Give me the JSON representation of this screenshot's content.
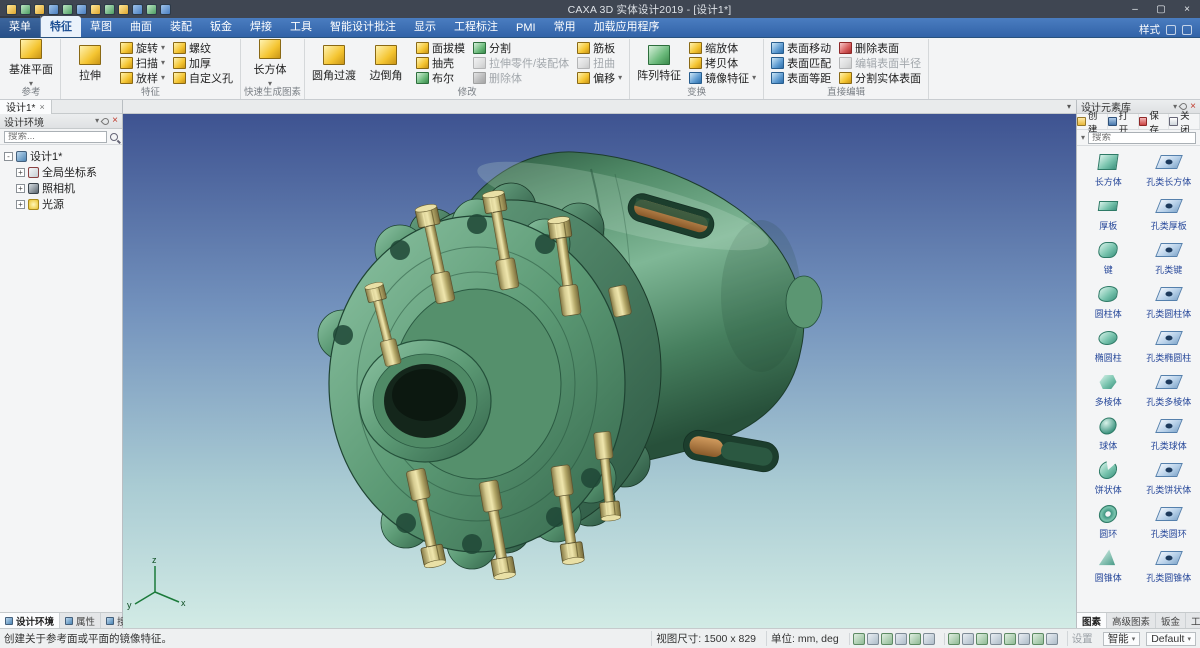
{
  "window": {
    "title": "CAXA 3D 实体设计2019 - [设计1*]",
    "qat_icons": [
      {
        "icon": "app-logo"
      },
      {
        "icon": "new-file"
      },
      {
        "icon": "open-file"
      },
      {
        "icon": "save-file"
      },
      {
        "icon": "print"
      },
      {
        "icon": "undo"
      },
      {
        "icon": "redo"
      },
      {
        "icon": "display-mode"
      },
      {
        "icon": "zoom-all"
      },
      {
        "icon": "settings"
      },
      {
        "icon": "help"
      },
      {
        "icon": "customize"
      }
    ],
    "controls": [
      {
        "icon": "minimize",
        "glyph": "–"
      },
      {
        "icon": "maximize",
        "glyph": "▢"
      },
      {
        "icon": "close",
        "glyph": "×"
      }
    ]
  },
  "menubar": {
    "tabs": [
      {
        "label": "菜单",
        "menu": true
      },
      {
        "label": "特征",
        "active": true
      },
      {
        "label": "草图"
      },
      {
        "label": "曲面"
      },
      {
        "label": "装配"
      },
      {
        "label": "钣金"
      },
      {
        "label": "焊接"
      },
      {
        "label": "工具"
      },
      {
        "label": "智能设计批注"
      },
      {
        "label": "显示"
      },
      {
        "label": "工程标注"
      },
      {
        "label": "PMI"
      },
      {
        "label": "常用"
      },
      {
        "label": "加载应用程序"
      }
    ],
    "style_label": "样式"
  },
  "ribbon": {
    "groups": [
      {
        "label": "参考",
        "items": [
          {
            "label": "基准平面",
            "icon": "datum-plane",
            "big": true,
            "arrow": true
          }
        ]
      },
      {
        "label": "特征",
        "items": [
          {
            "label": "拉伸",
            "icon": "extrude",
            "big": true
          },
          {
            "label": "旋转",
            "icon": "revolve",
            "arrow": true
          },
          {
            "label": "扫描",
            "icon": "sweep",
            "arrow": true
          },
          {
            "label": "放样",
            "icon": "loft",
            "arrow": true
          },
          {
            "label": "螺纹",
            "icon": "thread"
          },
          {
            "label": "加厚",
            "icon": "thicken"
          },
          {
            "label": "自定义孔",
            "icon": "custom-hole"
          }
        ]
      },
      {
        "label": "快速生成图素",
        "items": [
          {
            "label": "长方体",
            "icon": "box-primitive",
            "big": true,
            "arrow": true
          }
        ]
      },
      {
        "label": "修改",
        "items": [
          {
            "label": "圆角过渡",
            "icon": "fillet",
            "big": true
          },
          {
            "label": "边倒角",
            "icon": "chamfer",
            "big": true
          },
          {
            "label": "面拔模",
            "icon": "draft"
          },
          {
            "label": "抽壳",
            "icon": "shell"
          },
          {
            "label": "布尔",
            "icon": "boolean"
          },
          {
            "label": "分割",
            "icon": "split"
          },
          {
            "label": "拉伸零件/装配体",
            "icon": "stretch-part",
            "disabled": true
          },
          {
            "label": "删除体",
            "icon": "delete-body",
            "disabled": true
          },
          {
            "label": "筋板",
            "icon": "rib"
          },
          {
            "label": "扭曲",
            "icon": "twist",
            "disabled": true
          },
          {
            "label": "偏移",
            "icon": "offset",
            "arrow": true
          }
        ]
      },
      {
        "label": "变换",
        "items": [
          {
            "label": "阵列特征",
            "icon": "pattern",
            "big": true
          },
          {
            "label": "缩放体",
            "icon": "scale-body"
          },
          {
            "label": "拷贝体",
            "icon": "copy-body"
          },
          {
            "label": "镜像特征",
            "icon": "mirror",
            "arrow": true
          }
        ]
      },
      {
        "label": "直接编辑",
        "items": [
          {
            "label": "表面移动",
            "icon": "face-move"
          },
          {
            "label": "表面匹配",
            "icon": "face-match"
          },
          {
            "label": "表面等距",
            "icon": "face-offset"
          },
          {
            "label": "删除表面",
            "icon": "face-delete"
          },
          {
            "label": "编辑表面半径",
            "icon": "face-radius",
            "disabled": true
          },
          {
            "label": "分割实体表面",
            "icon": "face-split"
          }
        ]
      }
    ]
  },
  "doc_tab": {
    "label": "设计1*",
    "close": "×"
  },
  "left_panel": {
    "title": "设计环境",
    "search_placeholder": "搜索...",
    "tree": [
      {
        "exp": "-",
        "label": "设计1*",
        "icon": "design-root"
      },
      {
        "exp": "+",
        "label": "全局坐标系",
        "icon": "coordinate-system",
        "child": true
      },
      {
        "exp": "+",
        "label": "照相机",
        "icon": "camera",
        "child": true
      },
      {
        "exp": "+",
        "label": "光源",
        "icon": "light-source",
        "child": true
      }
    ],
    "bottom_tabs": [
      {
        "label": "设计环境",
        "icon": "design-env",
        "active": true
      },
      {
        "label": "属性",
        "icon": "properties"
      },
      {
        "label": "搜索",
        "icon": "search"
      }
    ]
  },
  "right_panel": {
    "title": "设计元素库",
    "toolbar": [
      {
        "label": "创建",
        "icon": "new-library"
      },
      {
        "label": "打开",
        "icon": "open-library"
      },
      {
        "label": "保存",
        "icon": "save-library"
      },
      {
        "label": "关闭",
        "icon": "close-library"
      }
    ],
    "search_placeholder": "搜索",
    "items": [
      {
        "label": "长方体",
        "icon": "solid-box"
      },
      {
        "label": "孔类长方体",
        "icon": "hole-box"
      },
      {
        "label": "厚板",
        "icon": "solid-slab"
      },
      {
        "label": "孔类厚板",
        "icon": "hole-slab"
      },
      {
        "label": "键",
        "icon": "solid-key"
      },
      {
        "label": "孔类键",
        "icon": "hole-key"
      },
      {
        "label": "圆柱体",
        "icon": "solid-cylinder"
      },
      {
        "label": "孔类圆柱体",
        "icon": "hole-cylinder"
      },
      {
        "label": "椭圆柱",
        "icon": "solid-ellipse"
      },
      {
        "label": "孔类椭圆柱",
        "icon": "hole-ellipse"
      },
      {
        "label": "多棱体",
        "icon": "solid-prism"
      },
      {
        "label": "孔类多棱体",
        "icon": "hole-prism"
      },
      {
        "label": "球体",
        "icon": "solid-sphere"
      },
      {
        "label": "孔类球体",
        "icon": "hole-sphere"
      },
      {
        "label": "饼状体",
        "icon": "solid-pie"
      },
      {
        "label": "孔类饼状体",
        "icon": "hole-pie"
      },
      {
        "label": "圆环",
        "icon": "solid-torus"
      },
      {
        "label": "孔类圆环",
        "icon": "hole-torus"
      },
      {
        "label": "圆锥体",
        "icon": "solid-cone"
      },
      {
        "label": "孔类圆锥体",
        "icon": "hole-cone"
      }
    ],
    "bottom_tabs": [
      {
        "label": "图素",
        "active": true
      },
      {
        "label": "高级图素"
      },
      {
        "label": "钣金"
      },
      {
        "label": "工具"
      }
    ]
  },
  "viewport": {
    "triad": {
      "x": "x",
      "y": "y",
      "z": "z"
    }
  },
  "status_bar": {
    "message": "创建关于参考面或平面的镜像特征。",
    "view_size": "视图尺寸: 1500 x 829",
    "units": "单位: mm, deg",
    "view_icons": [
      {
        "icon": "zoom-search"
      },
      {
        "icon": "zoom-in"
      },
      {
        "icon": "zoom-out"
      },
      {
        "icon": "zoom-fit"
      },
      {
        "icon": "pan-view"
      },
      {
        "icon": "rotate-view"
      }
    ],
    "display_icons": [
      {
        "icon": "wireframe-mode"
      },
      {
        "icon": "shaded-mode"
      },
      {
        "icon": "render-mode"
      },
      {
        "icon": "perspective-mode"
      },
      {
        "icon": "camera-view"
      },
      {
        "icon": "grid-toggle"
      },
      {
        "icon": "snap-toggle"
      },
      {
        "icon": "select-filter"
      }
    ],
    "settings_label": "设置",
    "smart_label": "智能",
    "default_label": "Default"
  }
}
